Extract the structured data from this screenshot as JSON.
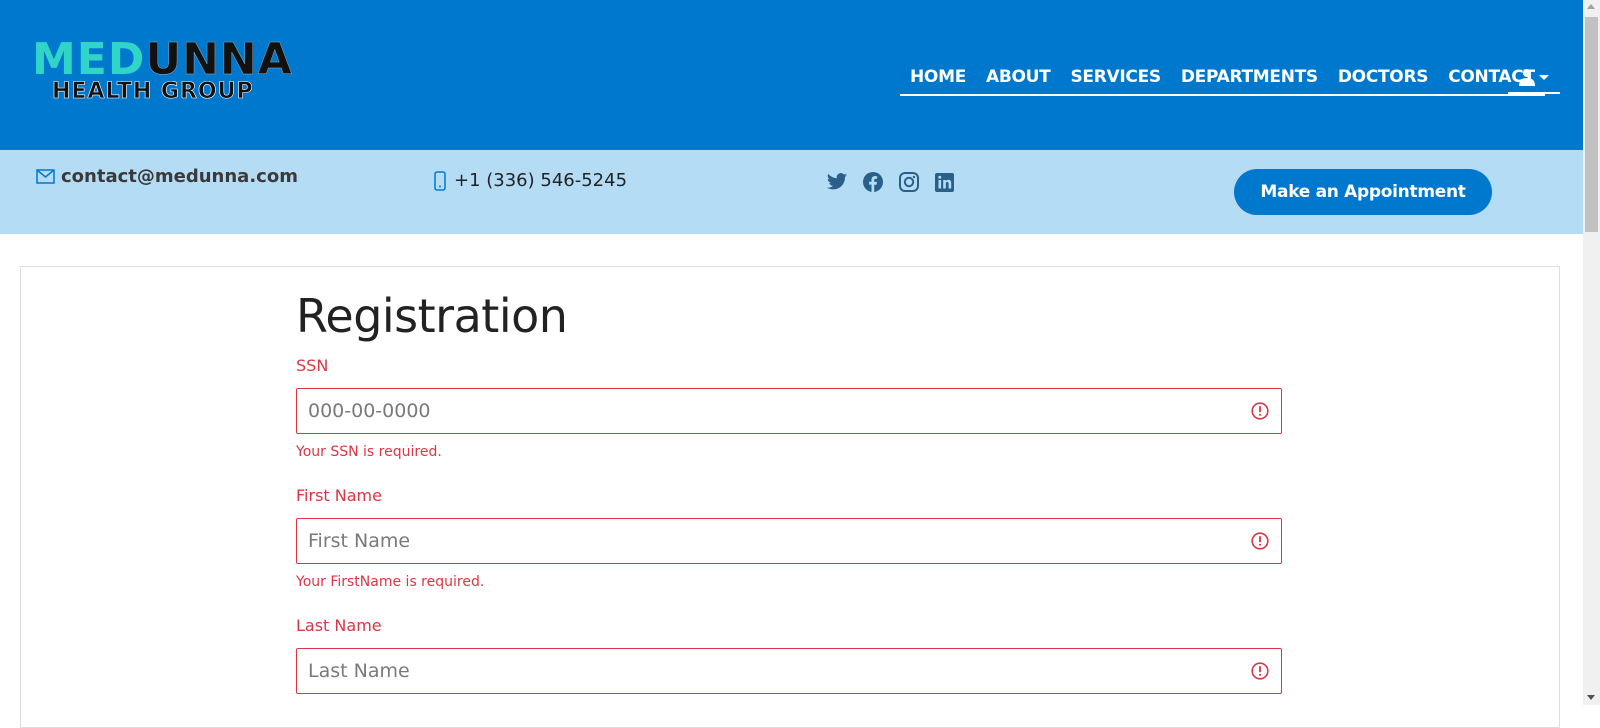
{
  "brand": {
    "logo_line1_part1": "MED",
    "logo_line1_part2": "UNNA",
    "logo_line2": "HEALTH GROUP"
  },
  "nav": {
    "items": [
      "HOME",
      "ABOUT",
      "SERVICES",
      "DEPARTMENTS",
      "DOCTORS",
      "CONTACT"
    ],
    "user_icon": "user-icon"
  },
  "infobar": {
    "email": "contact@medunna.com",
    "phone": "+1 (336) 546-5245",
    "socials": [
      "twitter-icon",
      "facebook-icon",
      "instagram-icon",
      "linkedin-icon"
    ],
    "appointment_button": "Make an Appointment"
  },
  "form": {
    "title": "Registration",
    "fields": [
      {
        "label": "SSN",
        "value": "",
        "placeholder": "000-00-0000",
        "error": "Your SSN is required."
      },
      {
        "label": "First Name",
        "value": "",
        "placeholder": "First Name",
        "error": "Your FirstName is required."
      },
      {
        "label": "Last Name",
        "value": "",
        "placeholder": "Last Name",
        "error": ""
      }
    ]
  },
  "colors": {
    "primary": "#0078cd",
    "infobar": "#b5dcf5",
    "error": "#dc3545",
    "logo_accent": "#2fd6c8"
  }
}
